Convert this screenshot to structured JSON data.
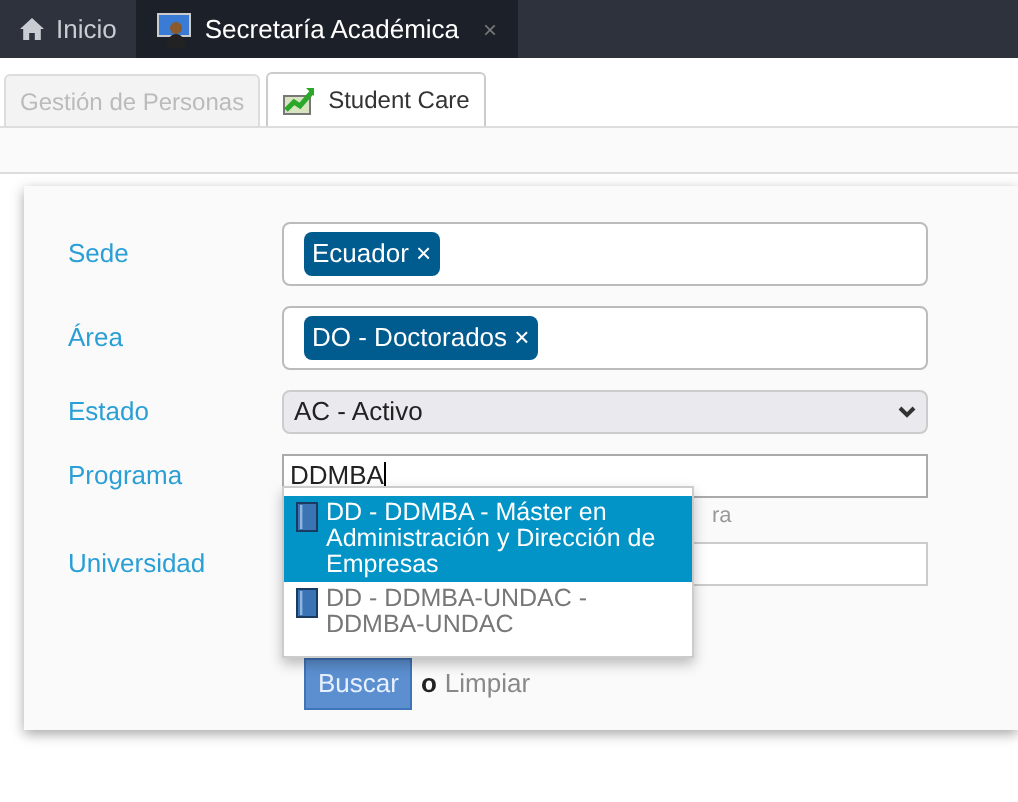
{
  "top_tabs": [
    {
      "label": "Inicio",
      "selected": false
    },
    {
      "label": "Secretaría Académica",
      "selected": true,
      "close": "×"
    }
  ],
  "sub_tabs": [
    {
      "label": "Gestión de Personas",
      "selected": false
    },
    {
      "label": "Student Care",
      "selected": true
    }
  ],
  "form": {
    "fields": [
      {
        "kind": "tags",
        "label": "Sede",
        "tags": [
          {
            "text": "Ecuador",
            "remove": "×"
          }
        ]
      },
      {
        "kind": "tags",
        "label": "Área",
        "tags": [
          {
            "text": "DO - Doctorados",
            "remove": "×"
          }
        ]
      },
      {
        "kind": "select",
        "label": "Estado",
        "value": "AC - Activo"
      },
      {
        "kind": "text",
        "label": "Programa",
        "value": "DDMBA",
        "hint": "ra",
        "focused": true
      },
      {
        "kind": "text",
        "label": "Universidad",
        "focused": false
      }
    ],
    "suggestions": [
      {
        "text": "DD - DDMBA - Máster en Administración y Dirección de Empresas",
        "selected": true
      },
      {
        "text": "DD - DDMBA-UNDAC - DDMBA-UNDAC",
        "selected": false
      }
    ],
    "search_button": "Buscar",
    "or": "o",
    "clear_link": "Limpiar"
  }
}
